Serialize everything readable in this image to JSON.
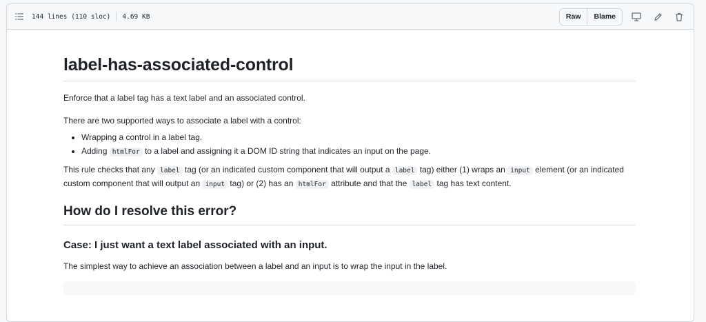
{
  "header": {
    "lines_info": "144 lines (110 sloc)",
    "size": "4.69 KB",
    "raw_label": "Raw",
    "blame_label": "Blame"
  },
  "doc": {
    "title": "label-has-associated-control",
    "intro": "Enforce that a label tag has a text label and an associated control.",
    "ways": "There are two supported ways to associate a label with a control:",
    "bullet1": "Wrapping a control in a label tag.",
    "bullet2": {
      "pre": "Adding ",
      "code": "htmlFor",
      "post": " to a label and assigning it a DOM ID string that indicates an input on the page."
    },
    "rule": {
      "t1": "This rule checks that any ",
      "c1": "label",
      "t2": " tag (or an indicated custom component that will output a ",
      "c2": "label",
      "t3": " tag) either (1) wraps an ",
      "c3": "input",
      "t4": " element (or an indicated custom component that will output an ",
      "c4": "input",
      "t5": " tag) or (2) has an ",
      "c5": "htmlFor",
      "t6": " attribute and that the ",
      "c6": "label",
      "t7": " tag has text content."
    },
    "h2": "How do I resolve this error?",
    "h3": "Case: I just want a text label associated with an input.",
    "simplest": "The simplest way to achieve an association between a label and an input is to wrap the input in the label."
  }
}
